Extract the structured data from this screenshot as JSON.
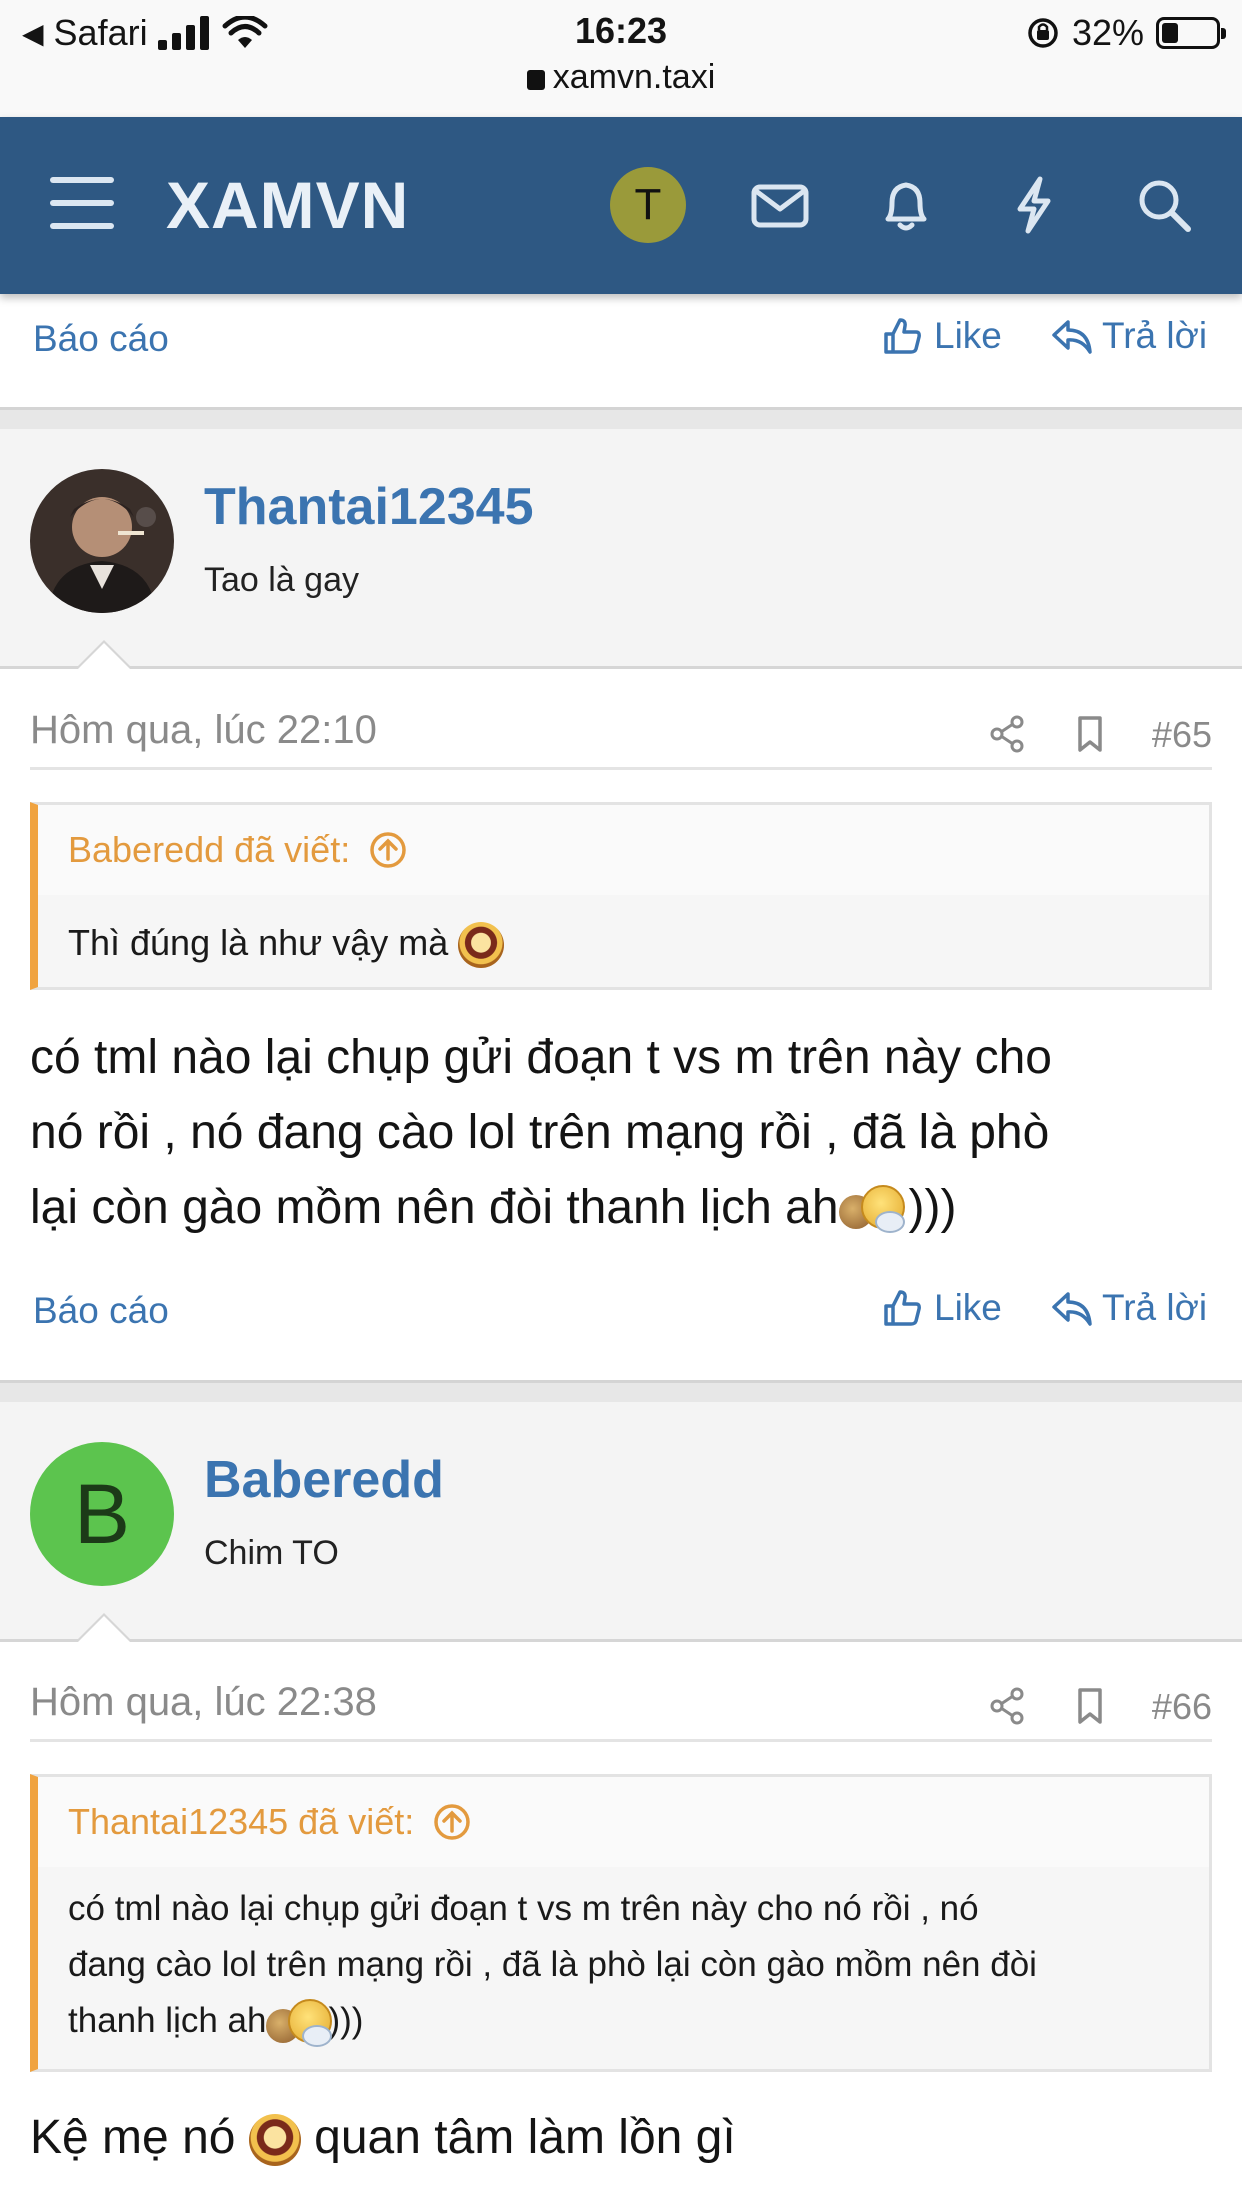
{
  "status_bar": {
    "back_app": "Safari",
    "time": "16:23",
    "battery": "32%",
    "url": "xamvn.taxi"
  },
  "header": {
    "logo": "XAMVN",
    "avatar_letter": "T",
    "icons": [
      "menu-icon",
      "mail-icon",
      "bell-icon",
      "lightning-icon",
      "search-icon"
    ],
    "brand_color": "#2e5883"
  },
  "actions": {
    "report": "Báo cáo",
    "like": "Like",
    "reply": "Trả lời"
  },
  "posts": [
    {
      "author": "Thantai12345",
      "user_title": "Tao là gay",
      "date": "Hôm qua, lúc 22:10",
      "number": "#65",
      "quote": {
        "author": "Baberedd đã viết:",
        "text": "Thì đúng là như vậy mà"
      },
      "text_lines": [
        "có tml nào lại chụp gửi đoạn t vs m trên này cho",
        "nó rồi , nó đang cào lol trên mạng rồi , đã là phò",
        "lại còn gào mồm nên đòi thanh lịch ah"
      ],
      "text_suffix": ")))"
    },
    {
      "author": "Baberedd",
      "avatar_letter": "B",
      "avatar_color": "#5cc44e",
      "user_title": "Chim TO",
      "date": "Hôm qua, lúc 22:38",
      "number": "#66",
      "quote": {
        "author": "Thantai12345 đã viết:",
        "lines": [
          "có tml nào lại chụp gửi đoạn t vs m trên này cho nó rồi , nó",
          "đang cào lol trên mạng rồi , đã là phò lại còn gào mồm nên đòi",
          "thanh lịch ah"
        ],
        "suffix": ")))"
      },
      "text_before": "Kệ mẹ nó",
      "text_after": "quan tâm làm lồn gì"
    }
  ]
}
